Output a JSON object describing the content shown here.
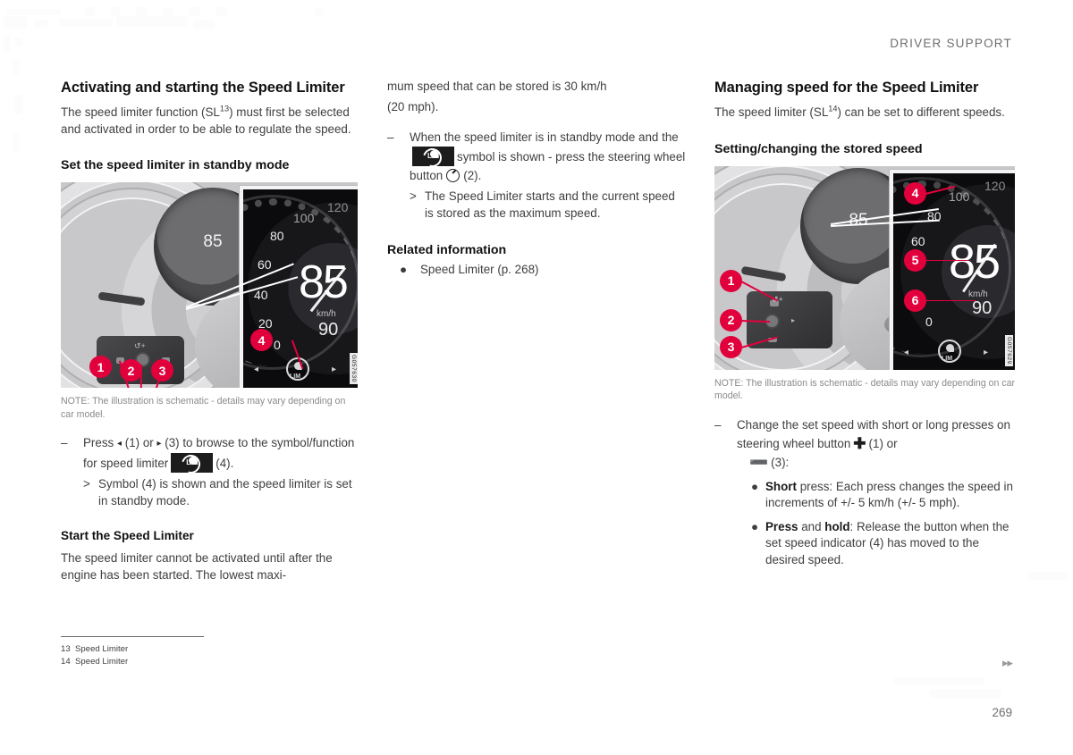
{
  "header": {
    "running_head": "DRIVER SUPPORT"
  },
  "footer": {
    "page_number": "269",
    "forward_arrows": "▸▸"
  },
  "col1": {
    "h1": "Activating and starting the Speed Limiter",
    "intro_a": "The speed limiter function (SL",
    "intro_sup": "13",
    "intro_b": ") must first be selected and activated in order to be able to regulate the speed.",
    "h2": "Set the speed limiter in standby mode",
    "figure_caption": "NOTE: The illustration is schematic - details may vary depending on car model.",
    "figure_watermark": "G057630",
    "figure_cluster_speed": "85",
    "figure_inset": {
      "ticks": [
        "0",
        "20",
        "40",
        "60",
        "80",
        "100",
        "120"
      ],
      "big_value": "85",
      "unit": "km/h",
      "sub_value": "90"
    },
    "figure_callouts": [
      "1",
      "2",
      "3",
      "4"
    ],
    "step_dash": "–",
    "step_text_a": "Press",
    "arrow_left": "◂",
    "step_text_b": "(1) or",
    "arrow_right": "▸",
    "step_text_c": "(3) to browse to the symbol/function for speed limiter",
    "step_text_d": "(4).",
    "substep_mark": ">",
    "substep_text": "Symbol (4) is shown and the speed limiter is set in standby mode.",
    "h3": "Start the Speed Limiter",
    "body2": "The speed limiter cannot be activated until after the engine has been started. The lowest maxi-"
  },
  "col2": {
    "cont_a": "mum speed that can be stored is 30 km/h",
    "cont_b": "(20 mph).",
    "step_dash": "–",
    "step_text_a": "When the speed limiter is in standby mode and the",
    "step_text_b": "symbol is shown - press the steering wheel button",
    "step_text_c": "(2).",
    "substep_mark": ">",
    "substep_text": "The Speed Limiter starts and the current speed is stored as the maximum speed.",
    "h2_related": "Related information",
    "related_bullet": "●",
    "related_link": "Speed Limiter (p. 268)"
  },
  "col3": {
    "h1": "Managing speed for the Speed Limiter",
    "intro_a": "The speed limiter (SL",
    "intro_sup": "14",
    "intro_b": ") can be set to different speeds.",
    "h2": "Setting/changing the stored speed",
    "figure_caption": "NOTE: The illustration is schematic - details may vary depending on car model.",
    "figure_watermark": "G057629",
    "figure_cluster_speed": "85",
    "figure_inset": {
      "ticks": [
        "0",
        "60",
        "80",
        "100",
        "120"
      ],
      "big_value": "85",
      "unit": "km/h",
      "sub_value": "90"
    },
    "figure_callouts": [
      "1",
      "2",
      "3",
      "4",
      "5",
      "6"
    ],
    "step_dash": "–",
    "step_text_a": "Change the set speed with short or long presses on steering wheel button",
    "step_text_b": "(1) or",
    "step_text_c": "(3):",
    "bullet": "●",
    "b1_bold": "Short",
    "b1_text": " press: Each press changes the speed in increments of +/- 5 km/h (+/- 5 mph).",
    "b2_bold1": "Press",
    "b2_mid": " and ",
    "b2_bold2": "hold",
    "b2_text": ": Release the button when the set speed indicator (4) has moved to the desired speed."
  },
  "footnotes": [
    {
      "num": "13",
      "text": "Speed Limiter"
    },
    {
      "num": "14",
      "text": "Speed Limiter"
    }
  ]
}
